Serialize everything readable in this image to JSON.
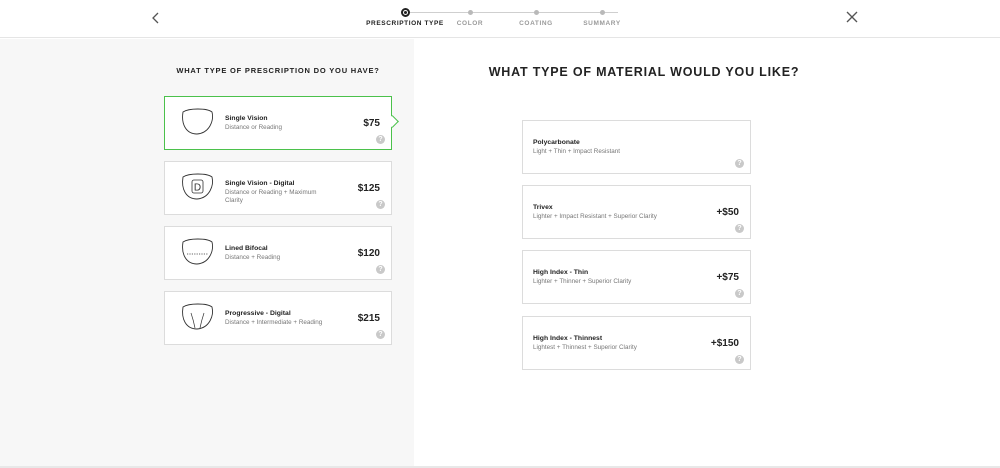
{
  "stepper": {
    "steps": [
      {
        "label": "PRESCRIPTION TYPE",
        "active": true
      },
      {
        "label": "COLOR",
        "active": false
      },
      {
        "label": "COATING",
        "active": false
      },
      {
        "label": "SUMMARY",
        "active": false
      }
    ]
  },
  "icons": {
    "back": "chevron-left-icon",
    "close": "close-icon",
    "help": "?"
  },
  "left": {
    "heading": "WHAT TYPE OF PRESCRIPTION DO YOU HAVE?",
    "options": [
      {
        "name": "Single Vision",
        "desc": "Distance or Reading",
        "price": "$75",
        "selected": true
      },
      {
        "name": "Single Vision - Digital",
        "desc": "Distance or Reading + Maximum Clarity",
        "price": "$125",
        "selected": false
      },
      {
        "name": "Lined Bifocal",
        "desc": "Distance + Reading",
        "price": "$120",
        "selected": false
      },
      {
        "name": "Progressive - Digital",
        "desc": "Distance + Intermediate + Reading",
        "price": "$215",
        "selected": false
      }
    ]
  },
  "right": {
    "heading": "WHAT TYPE OF MATERIAL WOULD YOU LIKE?",
    "options": [
      {
        "name": "Polycarbonate",
        "desc": "Light + Thin + Impact Resistant",
        "price": ""
      },
      {
        "name": "Trivex",
        "desc": "Lighter + Impact Resistant + Superior Clarity",
        "price": "+$50"
      },
      {
        "name": "High Index - Thin",
        "desc": "Lighter + Thinner + Superior Clarity",
        "price": "+$75"
      },
      {
        "name": "High Index - Thinnest",
        "desc": "Lightest + Thinnest + Superior Clarity",
        "price": "+$150"
      }
    ]
  },
  "colors": {
    "selected_border": "#4bc14b",
    "card_border": "#dcdcdc",
    "left_bg": "#f7f7f7"
  }
}
